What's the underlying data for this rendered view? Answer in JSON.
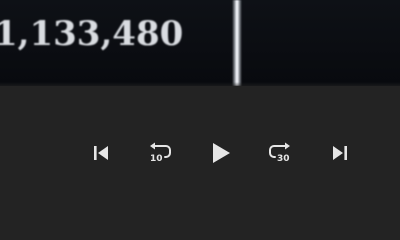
{
  "video": {
    "overlay_text": "1,133,480"
  },
  "controls": {
    "skip_back_seconds": "10",
    "skip_forward_seconds": "30",
    "icons": [
      "skip-previous-icon",
      "rewind-10-icon",
      "play-icon",
      "forward-30-icon",
      "skip-next-icon"
    ]
  },
  "colors": {
    "control_bar_bg": "#232323",
    "icon": "#e6e6e6"
  }
}
